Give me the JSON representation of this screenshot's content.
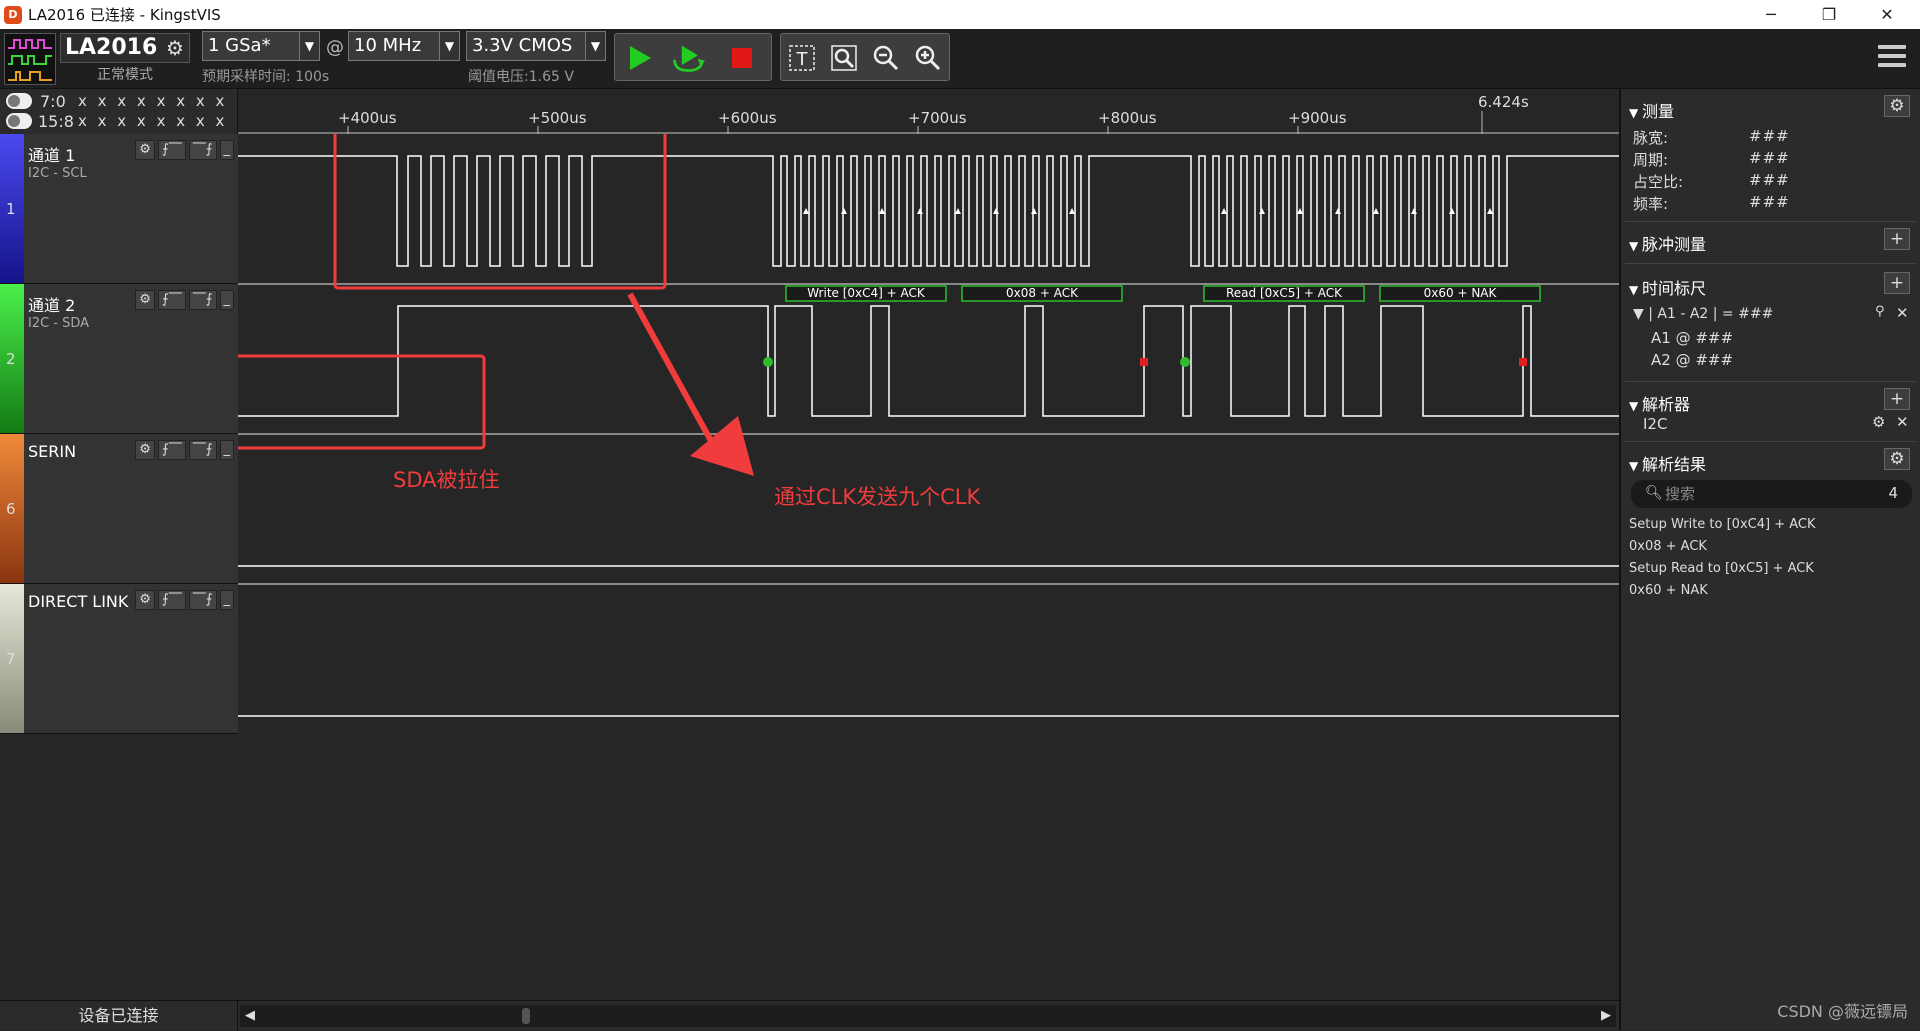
{
  "window": {
    "app_icon": "D",
    "title": "LA2016 已连接 - KingstVIS",
    "controls": [
      "─",
      "❐",
      "✕"
    ]
  },
  "toolbar": {
    "device_name": "LA2016",
    "device_mode": "正常模式",
    "sample_rate": "1 GSa*",
    "at": "@",
    "sample_depth": "10 MHz",
    "threshold": "3.3V CMOS",
    "sample_time_note": "预期采样时间: 100s",
    "threshold_note": "阈值电压:1.65 V"
  },
  "channel_header": [
    {
      "label": "7:0",
      "bits": "x x x x x x x x"
    },
    {
      "label": "15:8",
      "bits": "x x x x x x x x"
    }
  ],
  "channels": [
    {
      "num": "1",
      "name": "通道 1",
      "sub": "I2C - SCL",
      "color": "#2a2adb"
    },
    {
      "num": "2",
      "name": "通道 2",
      "sub": "I2C - SDA",
      "color": "#2dbd2d"
    },
    {
      "num": "6",
      "name": "SERIN",
      "sub": "",
      "color": "#d9641a"
    },
    {
      "num": "7",
      "name": "DIRECT LINK",
      "sub": "",
      "color": "#d6d6c8"
    }
  ],
  "ruler": {
    "ticks": [
      "+400us",
      "+500us",
      "+600us",
      "+700us",
      "+800us",
      "+900us"
    ],
    "cursor": "6.424s"
  },
  "decode_labels": [
    "Write [0xC4] + ACK",
    "0x08 + ACK",
    "Read [0xC5] + ACK",
    "0x60 + NAK"
  ],
  "annotations": {
    "sda_held": "SDA被拉住",
    "nine_clk": "通过CLK发送九个CLK"
  },
  "status": {
    "connection": "设备已连接"
  },
  "right_panel": {
    "measure": {
      "title": "测量",
      "rows": [
        {
          "label": "脉宽:",
          "value": "###"
        },
        {
          "label": "周期:",
          "value": "###"
        },
        {
          "label": "占空比:",
          "value": "###"
        },
        {
          "label": "频率:",
          "value": "###"
        }
      ]
    },
    "pulse_measure": {
      "title": "脉冲测量"
    },
    "timing_marker": {
      "title": "时间标尺",
      "pair": "| A1 - A2 | = ###",
      "a1": "A1 @ ###",
      "a2": "A2 @ ###"
    },
    "analyzer": {
      "title": "解析器",
      "item": "I2C"
    },
    "results": {
      "title": "解析结果",
      "search_placeholder": "搜索",
      "count": "4",
      "items": [
        "Setup Write to [0xC4] + ACK",
        "0x08 + ACK",
        "Setup Read to [0xC5] + ACK",
        "0x60 + NAK"
      ]
    }
  },
  "watermark": "CSDN @薇远镖局",
  "colors": {
    "background": "#262626",
    "waveform": "#ffffff",
    "annotation": "#f03c3c",
    "decode_box": "#2dbd2d",
    "start_marker": "#2dbd2d",
    "stop_marker": "#e02020"
  }
}
